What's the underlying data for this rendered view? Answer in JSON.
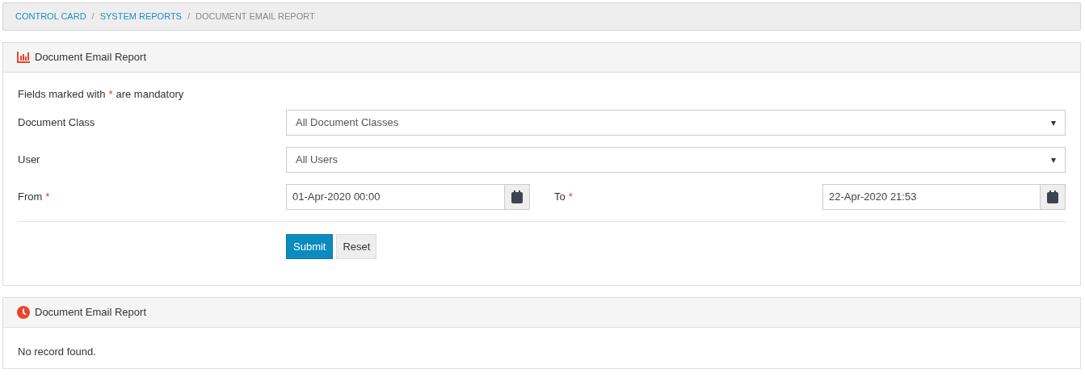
{
  "breadcrumb": [
    {
      "label": "CONTROL CARD",
      "kind": "link"
    },
    {
      "label": "SYSTEM REPORTS",
      "kind": "link"
    },
    {
      "label": "DOCUMENT EMAIL REPORT",
      "kind": "current"
    }
  ],
  "breadcrumb_separator": "/",
  "form_panel": {
    "title": "Document Email Report",
    "note_before": "Fields marked with",
    "required_mark": "*",
    "note_after": "are mandatory",
    "rows": [
      {
        "kind": "select",
        "label": "Document Class",
        "value": "All Document Classes",
        "caret": "▾"
      },
      {
        "kind": "select",
        "label": "User",
        "value": "All Users",
        "caret": "▾"
      },
      {
        "kind": "dates",
        "label": "From",
        "required": true,
        "value": "01-Apr-2020 00:00",
        "to_label": "To",
        "to_required": true,
        "to_value": "22-Apr-2020 21:53"
      }
    ],
    "buttons": [
      {
        "label": "Submit",
        "kind": "primary"
      },
      {
        "label": "Reset",
        "kind": "default"
      }
    ]
  },
  "results_panel": {
    "title": "Document Email Report",
    "message": "No record found."
  }
}
